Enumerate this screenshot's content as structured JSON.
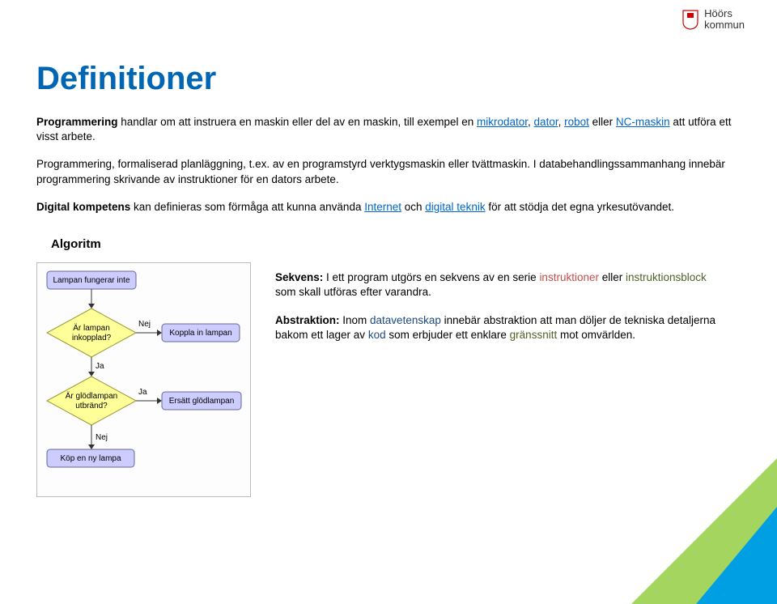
{
  "logo": {
    "line1": "Höörs",
    "line2": "kommun"
  },
  "title": "Definitioner",
  "p1_a": "Programmering",
  "p1_b": " handlar om att instruera en maskin eller del av en maskin, till exempel en ",
  "p1_l1": "mikrodator",
  "p1_c": ", ",
  "p1_l2": "dator",
  "p1_d": ", ",
  "p1_l3": "robot",
  "p1_e": " eller ",
  "p1_l4": "NC-maskin",
  "p1_f": " att utföra ett visst arbete.",
  "p2": "Programmering, formaliserad planläggning, t.ex. av en programstyrd verktygsmaskin eller tvättmaskin. I databehandlingssammanhang innebär programmering skrivande av instruktioner för en dators arbete.",
  "p3_a": "Digital kompetens",
  "p3_b": " kan definieras som förmåga att kunna använda ",
  "p3_l1": "Internet",
  "p3_c": " och ",
  "p3_l2": "digital teknik",
  "p3_d": " för att stödja det egna yrkesutövandet.",
  "subhead": "Algoritm",
  "seq_a": "Sekvens:",
  "seq_b": " I ett program utgörs en sekvens av en serie ",
  "seq_c": "instruktioner",
  "seq_d": " eller ",
  "seq_e": "instruktionsblock",
  "seq_f": " som skall utföras efter varandra.",
  "abs_a": "Abstraktion:",
  "abs_b": " Inom ",
  "abs_c": "datavetenskap",
  "abs_d": " innebär abstraktion att man döljer de tekniska detaljerna bakom ett lager av ",
  "abs_e": "kod",
  "abs_f": " som erbjuder ett enklare ",
  "abs_g": "gränssnitt",
  "abs_h": " mot omvärlden.",
  "fc": {
    "n1": "Lampan fungerar inte",
    "n2a": "Är lampan",
    "n2b": "inkopplad?",
    "n2nej": "Nej",
    "n2action": "Koppla in lampan",
    "n2ja": "Ja",
    "n3a": "Är glödlampan",
    "n3b": "utbränd?",
    "n3ja": "Ja",
    "n3action": "Ersätt glödlampan",
    "n3nej": "Nej",
    "n4": "Köp en ny lampa"
  }
}
